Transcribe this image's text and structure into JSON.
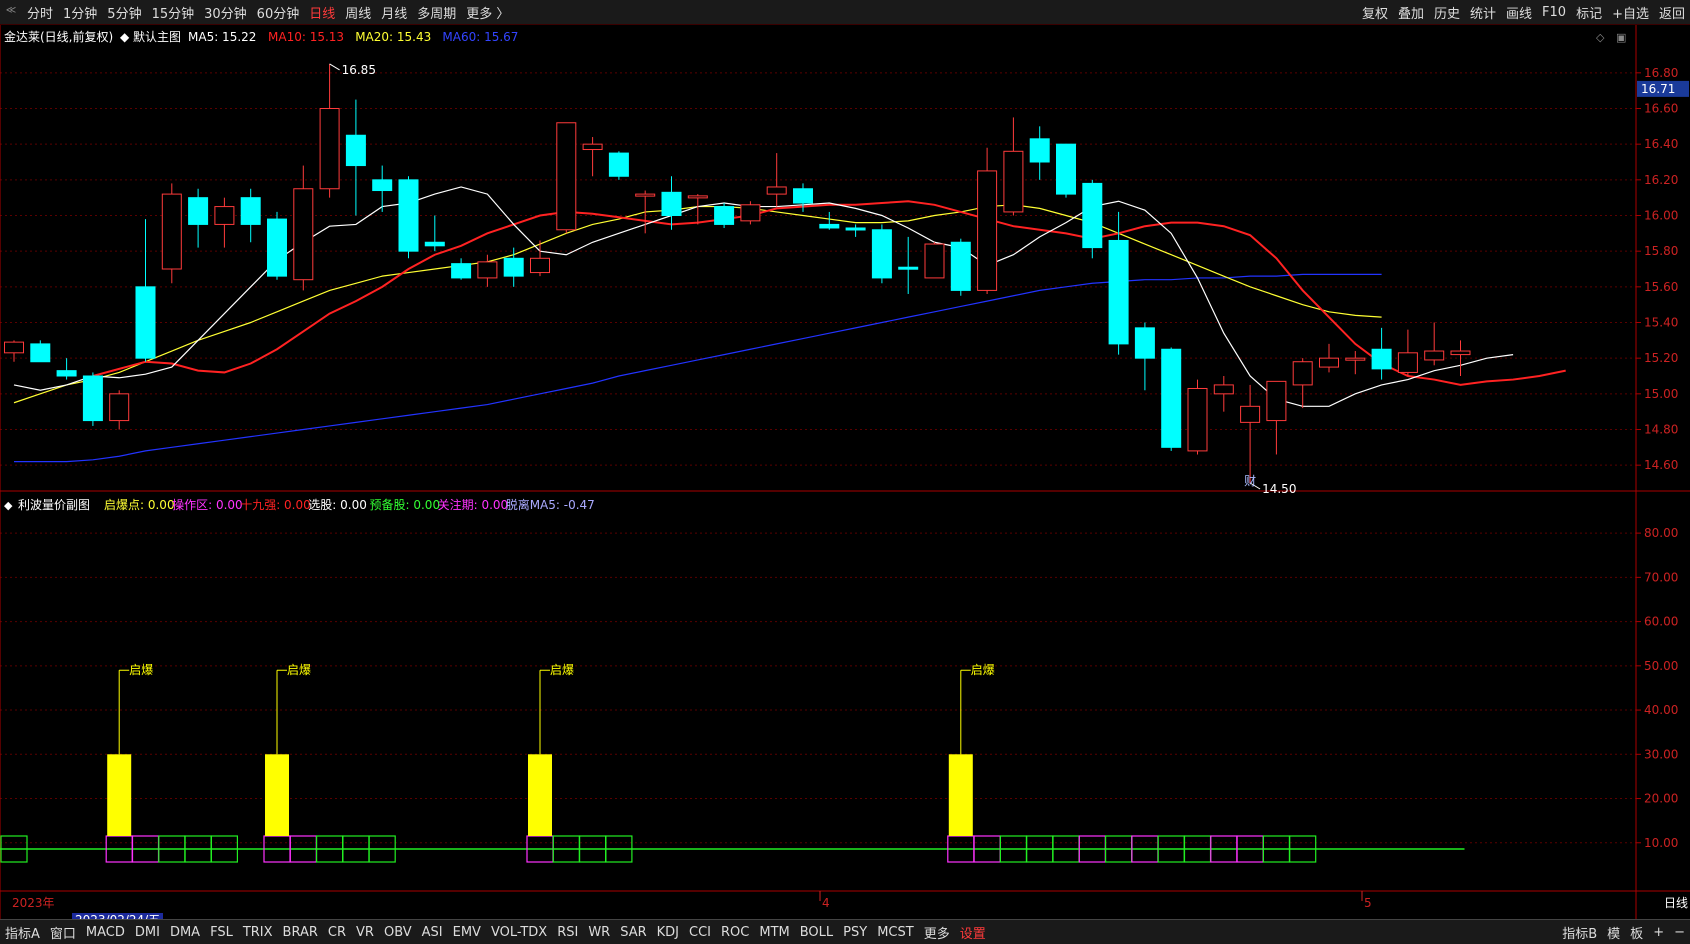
{
  "toolbar": {
    "timeframes": [
      "分时",
      "1分钟",
      "5分钟",
      "15分钟",
      "30分钟",
      "60分钟",
      "日线",
      "周线",
      "月线",
      "多周期",
      "更多 〉"
    ],
    "active_timeframe": "日线",
    "right_buttons": [
      "复权",
      "叠加",
      "历史",
      "统计",
      "画线",
      "F10",
      "标记",
      "+自选",
      "返回"
    ]
  },
  "main_panel": {
    "stock_label": "金达莱(日线,前复权)",
    "template_label": "◆ 默认主图",
    "ma_legend": [
      {
        "text": "MA5: 15.22",
        "color": "#ffffff"
      },
      {
        "text": "MA10: 15.13",
        "color": "#ff2222"
      },
      {
        "text": "MA20: 15.43",
        "color": "#ffff33"
      },
      {
        "text": "MA60: 15.67",
        "color": "#3344ff"
      }
    ],
    "current_price": "16.71",
    "high_label": "16.85",
    "low_label": "14.50",
    "event_marker": "财",
    "price_ticks": [
      "16.80",
      "16.60",
      "16.40",
      "16.20",
      "16.00",
      "15.80",
      "15.60",
      "15.40",
      "15.20",
      "15.00",
      "14.80",
      "14.60"
    ]
  },
  "sub_panel": {
    "title": "利波量价副图",
    "legend": [
      {
        "text": "启爆点: 0.00",
        "color": "#ffff33"
      },
      {
        "text": "操作区: 0.00",
        "color": "#ff33ff"
      },
      {
        "text": "十九强: 0.00",
        "color": "#ff2222"
      },
      {
        "text": "选股: 0.00",
        "color": "#ffffff"
      },
      {
        "text": "预备股: 0.00",
        "color": "#33ff33"
      },
      {
        "text": "关注期: 0.00",
        "color": "#ff33ff"
      },
      {
        "text": "脱离MA5: -0.47",
        "color": "#aaaaff"
      }
    ],
    "ticks": [
      "80.00",
      "70.00",
      "60.00",
      "50.00",
      "40.00",
      "30.00",
      "20.00",
      "10.00"
    ],
    "signal_label": "启爆"
  },
  "date_axis": {
    "year_label": "2023年",
    "cursor_date": "2023/02/24/五",
    "month_labels": [
      "4",
      "5"
    ],
    "right_label": "日线"
  },
  "indicator_tabs": [
    "指标A",
    "窗口",
    "MACD",
    "DMI",
    "DMA",
    "FSL",
    "TRIX",
    "BRAR",
    "CR",
    "VR",
    "OBV",
    "ASI",
    "EMV",
    "VOL-TDX",
    "RSI",
    "WR",
    "SAR",
    "KDJ",
    "CCI",
    "ROC",
    "MTM",
    "BOLL",
    "PSY",
    "MCST",
    "更多",
    "设置"
  ],
  "bottom_right": [
    "指标B",
    "模",
    "板",
    "+",
    "−"
  ],
  "colors": {
    "up": "#ff3b3b",
    "down": "#00ffff",
    "ma5": "#ffffff",
    "ma10": "#ff2222",
    "ma20": "#ffff33",
    "ma60": "#2233ff",
    "grid": "#5a0000",
    "signal": "#ffff00",
    "box_green": "#22ee22",
    "box_magenta": "#ff33ff"
  },
  "chart_data": {
    "type": "candlestick",
    "title": "金达莱(日线,前复权)",
    "ylim": [
      14.5,
      16.9
    ],
    "ohlc": [
      {
        "o": 15.23,
        "h": 15.3,
        "l": 15.18,
        "c": 15.29
      },
      {
        "o": 15.28,
        "h": 15.3,
        "l": 15.2,
        "c": 15.18
      },
      {
        "o": 15.13,
        "h": 15.2,
        "l": 15.08,
        "c": 15.1
      },
      {
        "o": 15.1,
        "h": 15.12,
        "l": 14.82,
        "c": 14.85
      },
      {
        "o": 14.85,
        "h": 15.02,
        "l": 14.8,
        "c": 15.0
      },
      {
        "o": 15.6,
        "h": 15.98,
        "l": 15.18,
        "c": 15.2
      },
      {
        "o": 15.7,
        "h": 16.18,
        "l": 15.62,
        "c": 16.12
      },
      {
        "o": 16.1,
        "h": 16.15,
        "l": 15.82,
        "c": 15.95
      },
      {
        "o": 15.95,
        "h": 16.1,
        "l": 15.82,
        "c": 16.05
      },
      {
        "o": 16.1,
        "h": 16.15,
        "l": 15.85,
        "c": 15.95
      },
      {
        "o": 15.98,
        "h": 16.02,
        "l": 15.64,
        "c": 15.66
      },
      {
        "o": 15.64,
        "h": 16.28,
        "l": 15.58,
        "c": 16.15
      },
      {
        "o": 16.15,
        "h": 16.85,
        "l": 16.1,
        "c": 16.6
      },
      {
        "o": 16.45,
        "h": 16.65,
        "l": 16.0,
        "c": 16.28
      },
      {
        "o": 16.2,
        "h": 16.28,
        "l": 16.02,
        "c": 16.14
      },
      {
        "o": 16.2,
        "h": 16.22,
        "l": 15.76,
        "c": 15.8
      },
      {
        "o": 15.85,
        "h": 16.0,
        "l": 15.8,
        "c": 15.83
      },
      {
        "o": 15.73,
        "h": 15.76,
        "l": 15.64,
        "c": 15.65
      },
      {
        "o": 15.65,
        "h": 15.78,
        "l": 15.6,
        "c": 15.74
      },
      {
        "o": 15.76,
        "h": 15.82,
        "l": 15.6,
        "c": 15.66
      },
      {
        "o": 15.68,
        "h": 15.86,
        "l": 15.66,
        "c": 15.76
      },
      {
        "o": 15.92,
        "h": 16.52,
        "l": 15.9,
        "c": 16.52
      },
      {
        "o": 16.37,
        "h": 16.44,
        "l": 16.22,
        "c": 16.4
      },
      {
        "o": 16.35,
        "h": 16.36,
        "l": 16.2,
        "c": 16.22
      },
      {
        "o": 16.12,
        "h": 16.14,
        "l": 15.9,
        "c": 16.12
      },
      {
        "o": 16.13,
        "h": 16.22,
        "l": 15.92,
        "c": 16.0
      },
      {
        "o": 16.1,
        "h": 16.12,
        "l": 15.95,
        "c": 16.11
      },
      {
        "o": 16.05,
        "h": 16.07,
        "l": 15.93,
        "c": 15.95
      },
      {
        "o": 15.97,
        "h": 16.08,
        "l": 15.95,
        "c": 16.06
      },
      {
        "o": 16.12,
        "h": 16.35,
        "l": 16.05,
        "c": 16.16
      },
      {
        "o": 16.15,
        "h": 16.18,
        "l": 16.02,
        "c": 16.07
      },
      {
        "o": 15.95,
        "h": 16.02,
        "l": 15.92,
        "c": 15.93
      },
      {
        "o": 15.93,
        "h": 15.95,
        "l": 15.88,
        "c": 15.92
      },
      {
        "o": 15.92,
        "h": 15.95,
        "l": 15.62,
        "c": 15.65
      },
      {
        "o": 15.71,
        "h": 15.88,
        "l": 15.56,
        "c": 15.7
      },
      {
        "o": 15.65,
        "h": 15.85,
        "l": 15.65,
        "c": 15.84
      },
      {
        "o": 15.85,
        "h": 15.87,
        "l": 15.55,
        "c": 15.58
      },
      {
        "o": 15.58,
        "h": 16.38,
        "l": 15.56,
        "c": 16.25
      },
      {
        "o": 16.02,
        "h": 16.55,
        "l": 16.0,
        "c": 16.36
      },
      {
        "o": 16.43,
        "h": 16.5,
        "l": 16.2,
        "c": 16.3
      },
      {
        "o": 16.4,
        "h": 16.4,
        "l": 16.1,
        "c": 16.12
      },
      {
        "o": 16.18,
        "h": 16.2,
        "l": 15.76,
        "c": 15.82
      },
      {
        "o": 15.86,
        "h": 16.02,
        "l": 15.22,
        "c": 15.28
      },
      {
        "o": 15.37,
        "h": 15.4,
        "l": 15.02,
        "c": 15.2
      },
      {
        "o": 15.25,
        "h": 15.26,
        "l": 14.68,
        "c": 14.7
      },
      {
        "o": 14.68,
        "h": 15.08,
        "l": 14.66,
        "c": 15.03
      },
      {
        "o": 15.0,
        "h": 15.1,
        "l": 14.9,
        "c": 15.05
      },
      {
        "o": 14.84,
        "h": 15.05,
        "l": 14.5,
        "c": 14.93
      },
      {
        "o": 14.85,
        "h": 15.07,
        "l": 14.66,
        "c": 15.07
      },
      {
        "o": 15.05,
        "h": 15.2,
        "l": 14.92,
        "c": 15.18
      },
      {
        "o": 15.15,
        "h": 15.28,
        "l": 15.12,
        "c": 15.2
      },
      {
        "o": 15.2,
        "h": 15.24,
        "l": 15.11,
        "c": 15.2
      },
      {
        "o": 15.25,
        "h": 15.37,
        "l": 15.08,
        "c": 15.14
      },
      {
        "o": 15.12,
        "h": 15.36,
        "l": 15.1,
        "c": 15.23
      },
      {
        "o": 15.19,
        "h": 15.4,
        "l": 15.16,
        "c": 15.24
      },
      {
        "o": 15.22,
        "h": 15.3,
        "l": 15.1,
        "c": 15.24
      }
    ],
    "ma5": [
      15.05,
      15.02,
      15.05,
      15.1,
      15.09,
      15.11,
      15.15,
      15.3,
      15.45,
      15.6,
      15.75,
      15.85,
      15.94,
      15.95,
      16.05,
      16.07,
      16.12,
      16.16,
      16.12,
      15.95,
      15.8,
      15.78,
      15.85,
      15.9,
      15.95,
      16.0,
      16.05,
      16.07,
      16.05,
      16.05,
      16.06,
      16.07,
      16.04,
      16.0,
      15.93,
      15.85,
      15.82,
      15.72,
      15.78,
      15.88,
      15.96,
      16.05,
      16.08,
      16.03,
      15.9,
      15.65,
      15.34,
      15.1,
      14.97,
      14.93,
      14.93,
      15.0,
      15.05,
      15.08,
      15.13,
      15.16,
      15.2,
      15.22
    ],
    "ma10": [
      15.1,
      15.14,
      15.18,
      15.17,
      15.13,
      15.12,
      15.17,
      15.25,
      15.35,
      15.45,
      15.52,
      15.6,
      15.7,
      15.78,
      15.83,
      15.9,
      15.95,
      16.0,
      16.02,
      16.01,
      15.99,
      15.97,
      15.95,
      15.96,
      15.98,
      16.0,
      16.04,
      16.05,
      16.06,
      16.06,
      16.07,
      16.08,
      16.06,
      16.02,
      15.98,
      15.94,
      15.92,
      15.9,
      15.87,
      15.9,
      15.94,
      15.96,
      15.96,
      15.94,
      15.89,
      15.76,
      15.58,
      15.43,
      15.28,
      15.17,
      15.1,
      15.08,
      15.05,
      15.07,
      15.08,
      15.1,
      15.13
    ],
    "ma20": [
      14.95,
      15.0,
      15.05,
      15.08,
      15.12,
      15.18,
      15.24,
      15.3,
      15.35,
      15.4,
      15.46,
      15.52,
      15.58,
      15.62,
      15.66,
      15.68,
      15.7,
      15.72,
      15.74,
      15.78,
      15.84,
      15.9,
      15.95,
      15.98,
      16.02,
      16.03,
      16.05,
      16.05,
      16.04,
      16.02,
      16.0,
      15.98,
      15.96,
      15.96,
      15.97,
      16.0,
      16.02,
      16.05,
      16.06,
      16.04,
      16.0,
      15.96,
      15.9,
      15.84,
      15.78,
      15.72,
      15.66,
      15.6,
      15.55,
      15.5,
      15.46,
      15.44,
      15.43
    ],
    "ma60": [
      14.62,
      14.62,
      14.62,
      14.63,
      14.65,
      14.68,
      14.7,
      14.72,
      14.74,
      14.76,
      14.78,
      14.8,
      14.82,
      14.84,
      14.86,
      14.88,
      14.9,
      14.92,
      14.94,
      14.97,
      15.0,
      15.03,
      15.06,
      15.1,
      15.13,
      15.16,
      15.19,
      15.22,
      15.25,
      15.28,
      15.31,
      15.34,
      15.37,
      15.4,
      15.43,
      15.46,
      15.49,
      15.52,
      15.55,
      15.58,
      15.6,
      15.62,
      15.63,
      15.64,
      15.64,
      15.65,
      15.65,
      15.66,
      15.66,
      15.67,
      15.67,
      15.67,
      15.67
    ],
    "signals": [
      {
        "index": 4,
        "value": 30,
        "label": "启爆"
      },
      {
        "index": 10,
        "value": 30,
        "label": "启爆"
      },
      {
        "index": 20,
        "value": 30,
        "label": "启爆"
      },
      {
        "index": 36,
        "value": 30,
        "label": "启爆"
      }
    ],
    "boxes": [
      {
        "index": 0,
        "color": "green"
      },
      {
        "index": 4,
        "color": "magenta"
      },
      {
        "index": 5,
        "color": "magenta"
      },
      {
        "index": 6,
        "color": "green"
      },
      {
        "index": 7,
        "color": "green"
      },
      {
        "index": 8,
        "color": "green"
      },
      {
        "index": 10,
        "color": "magenta"
      },
      {
        "index": 11,
        "color": "magenta"
      },
      {
        "index": 12,
        "color": "green"
      },
      {
        "index": 13,
        "color": "green"
      },
      {
        "index": 14,
        "color": "green"
      },
      {
        "index": 20,
        "color": "magenta"
      },
      {
        "index": 21,
        "color": "green"
      },
      {
        "index": 22,
        "color": "green"
      },
      {
        "index": 23,
        "color": "green"
      },
      {
        "index": 36,
        "color": "magenta"
      },
      {
        "index": 37,
        "color": "magenta"
      },
      {
        "index": 38,
        "color": "green"
      },
      {
        "index": 39,
        "color": "green"
      },
      {
        "index": 40,
        "color": "green"
      },
      {
        "index": 41,
        "color": "magenta"
      },
      {
        "index": 42,
        "color": "green"
      },
      {
        "index": 43,
        "color": "magenta"
      },
      {
        "index": 44,
        "color": "green"
      },
      {
        "index": 45,
        "color": "green"
      },
      {
        "index": 46,
        "color": "magenta"
      },
      {
        "index": 47,
        "color": "magenta"
      },
      {
        "index": 48,
        "color": "green"
      },
      {
        "index": 49,
        "color": "green"
      }
    ],
    "sub_ylim": [
      0,
      85
    ]
  }
}
